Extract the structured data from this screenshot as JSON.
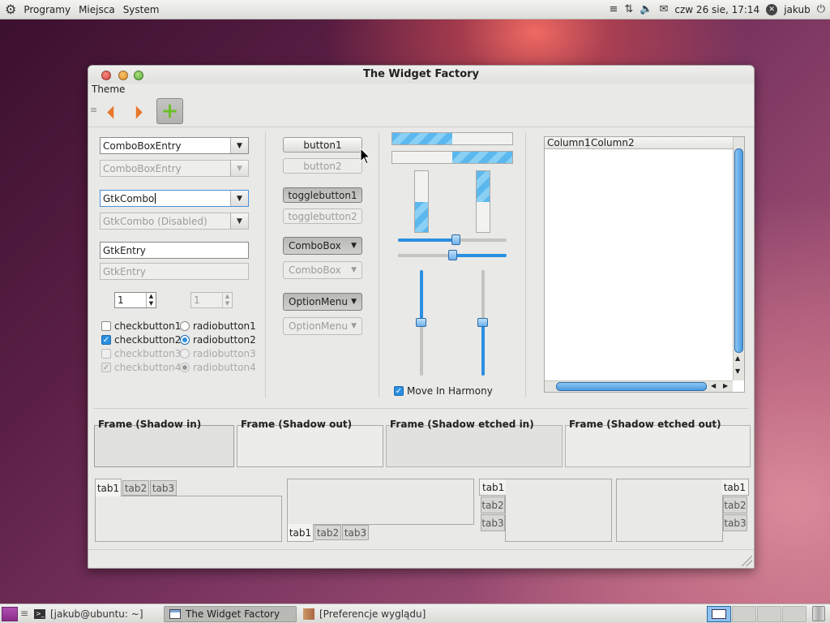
{
  "top_panel": {
    "menus": [
      "Programy",
      "Miejsca",
      "System"
    ],
    "datetime": "czw 26 sie, 17:14",
    "user": "jakub"
  },
  "window": {
    "title": "The Widget Factory",
    "menu": [
      "Theme"
    ],
    "combos": {
      "combo1": "ComboBoxEntry",
      "combo2": "ComboBoxEntry",
      "combo3": "GtkCombo",
      "combo4": "GtkCombo (Disabled)"
    },
    "entries": {
      "entry1": "GtkEntry",
      "entry2": "GtkEntry"
    },
    "spins": {
      "spin1": "1",
      "spin2": "1"
    },
    "checks": [
      "checkbutton1",
      "checkbutton2",
      "checkbutton3",
      "checkbutton4"
    ],
    "check_state": [
      false,
      true,
      false,
      true
    ],
    "radios": [
      "radiobutton1",
      "radiobutton2",
      "radiobutton3",
      "radiobutton4"
    ],
    "radio_selected": 2,
    "buttons": {
      "button1": "button1",
      "button2": "button2",
      "toggle1": "togglebutton1",
      "toggle2": "togglebutton2",
      "combobox1": "ComboBox",
      "combobox2": "ComboBox",
      "option1": "OptionMenu",
      "option2": "OptionMenu"
    },
    "progress": {
      "h1": 0.5,
      "h2": 0.5,
      "v1": 0.5,
      "v2": 0.5
    },
    "scales": {
      "h1": 0.55,
      "h2": 0.5,
      "v1": 0.5,
      "v2": 0.5
    },
    "harmony_label": "Move In Harmony",
    "tree_columns": [
      "Column1",
      "Column2"
    ],
    "frames": [
      "Frame (Shadow in)",
      "Frame (Shadow out)",
      "Frame (Shadow etched in)",
      "Frame (Shadow etched out)"
    ],
    "tabs": [
      "tab1",
      "tab2",
      "tab3"
    ]
  },
  "taskbar": {
    "tasks": [
      "[jakub@ubuntu: ~]",
      "The Widget Factory",
      "[Preferencje wyglądu]"
    ]
  },
  "colors": {
    "accent": "#2a8fe0",
    "window_bg": "#e9e9e7",
    "toolbar_arrow": "#e8772a"
  }
}
